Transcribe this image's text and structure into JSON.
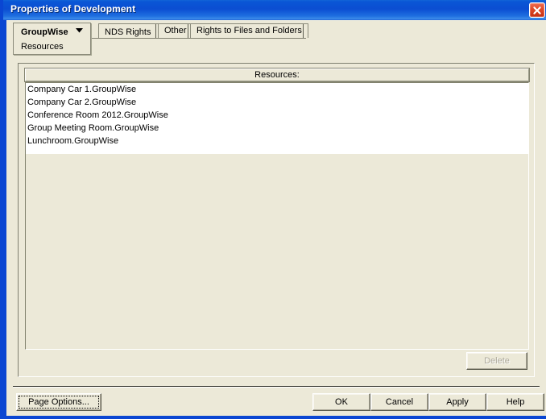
{
  "window": {
    "title": "Properties of Development",
    "close_icon": "close-icon",
    "title_bar_color": "#0a4ed2",
    "close_button_color": "#d8401c",
    "face_color": "#ece9d8"
  },
  "tabs": [
    {
      "label": "GroupWise",
      "sub_label": "Resources",
      "has_dropdown": true,
      "active": true
    },
    {
      "label": "NDS Rights",
      "sub_label": "",
      "has_dropdown": true,
      "active": false
    },
    {
      "label": "Other",
      "sub_label": "",
      "has_dropdown": false,
      "active": false
    },
    {
      "label": "Rights to Files and Folders",
      "sub_label": "",
      "has_dropdown": false,
      "active": false
    }
  ],
  "list": {
    "header": "Resources:",
    "items": [
      "Company Car 1.GroupWise",
      "Company Car 2.GroupWise",
      "Conference Room 2012.GroupWise",
      "Group Meeting Room.GroupWise",
      "Lunchroom.GroupWise"
    ]
  },
  "buttons": {
    "delete": {
      "label": "Delete",
      "enabled": false
    },
    "page_options": {
      "label": "Page Options...",
      "enabled": true,
      "focused": true
    },
    "ok": {
      "label": "OK",
      "enabled": true
    },
    "cancel": {
      "label": "Cancel",
      "enabled": true
    },
    "apply": {
      "label": "Apply",
      "enabled": true
    },
    "help": {
      "label": "Help",
      "enabled": true
    }
  }
}
